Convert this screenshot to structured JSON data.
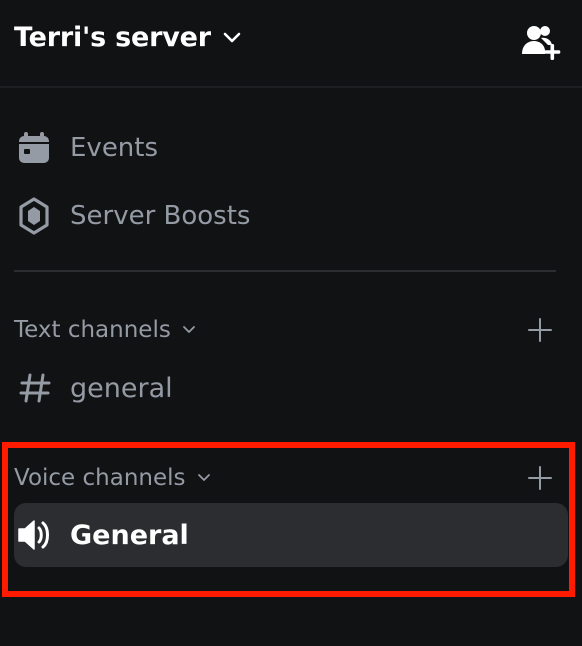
{
  "header": {
    "server_name": "Terri's server",
    "dropdown_icon": "chevron-down-icon",
    "invite_icon": "add-member-icon"
  },
  "menu": {
    "events": {
      "label": "Events",
      "icon": "calendar-icon"
    },
    "boosts": {
      "label": "Server Boosts",
      "icon": "boost-gem-icon"
    }
  },
  "categories": {
    "text": {
      "label": "Text channels",
      "chevron": "chevron-down-icon",
      "add_icon": "plus-icon"
    },
    "voice": {
      "label": "Voice channels",
      "chevron": "chevron-down-icon",
      "add_icon": "plus-icon"
    }
  },
  "channels": {
    "text_general": {
      "label": "general",
      "icon": "hash-icon"
    },
    "voice_general": {
      "label": "General",
      "icon": "speaker-icon",
      "selected": true
    }
  },
  "colors": {
    "background": "#111214",
    "muted_text": "#949ba4",
    "selected_bg": "#2b2d31",
    "highlight_border": "#ff1a00",
    "white": "#ffffff"
  }
}
